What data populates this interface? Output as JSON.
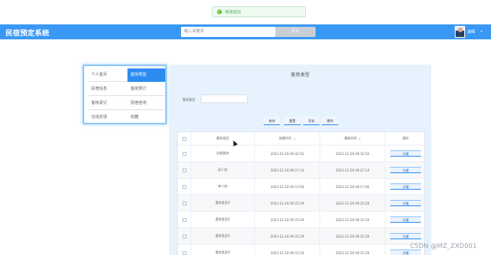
{
  "toast": {
    "icon": "success-check-icon",
    "text": "修改成功"
  },
  "header": {
    "brand": "民宿预定系统",
    "search_placeholder": "输入关键词",
    "search_button": "搜索",
    "username": "谢晖",
    "caret": "▾"
  },
  "menu": {
    "rows": [
      {
        "left": "个人首页",
        "right": "客房类型"
      },
      {
        "left": "民宿信息",
        "right": "客房预订"
      },
      {
        "left": "客房退订",
        "right": "民宿咨询"
      },
      {
        "left": "在线反馈",
        "right": "收藏"
      }
    ]
  },
  "panel": {
    "title": "客房类型",
    "filter_label": "客房类型",
    "buttons": [
      "查询",
      "重置",
      "添加",
      "删除"
    ]
  },
  "table": {
    "headers": [
      "客房类型",
      "创建时间",
      "更新时间",
      "操作"
    ],
    "sort_glyph": "↕",
    "detail_label": "详情",
    "rows": [
      {
        "type": "总统套房",
        "created": "2023-12-26 09:32:50",
        "updated": "2023-12-26 09:32:50"
      },
      {
        "type": "双人房",
        "created": "2023-12-26 09:17:14",
        "updated": "2023-12-26 09:17:14"
      },
      {
        "type": "单人房",
        "created": "2023-12-26 09:17:06",
        "updated": "2023-12-26 09:17:06"
      },
      {
        "type": "客房类型3",
        "created": "2023-12-26 09:15:29",
        "updated": "2023-12-26 09:15:29"
      },
      {
        "type": "客房类型2",
        "created": "2023-12-26 09:15:29",
        "updated": "2023-12-26 09:15:29"
      },
      {
        "type": "客房类型1",
        "created": "2023-12-26 09:15:29",
        "updated": "2023-12-26 09:15:29"
      },
      {
        "type": "客房类型4",
        "created": "2023-12-26 09:15:29",
        "updated": "2023-12-26 09:15:29"
      }
    ]
  },
  "watermark": "CSDN @MZ_ZXD001",
  "colors": {
    "primary": "#3a98f5",
    "active_menu": "#2d8cf0",
    "panel_bg": "#e6f2fd"
  }
}
